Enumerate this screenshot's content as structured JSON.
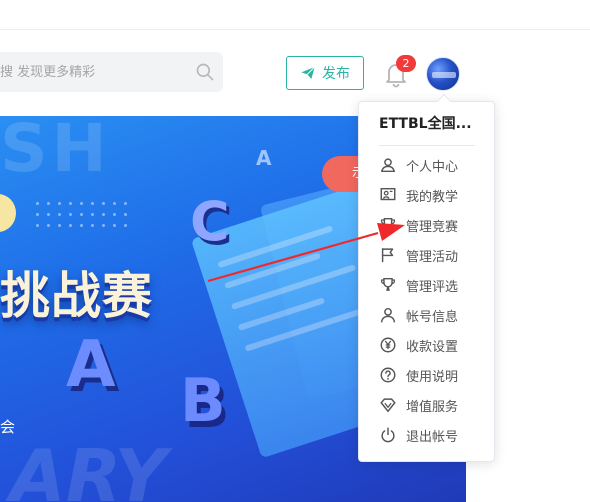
{
  "search": {
    "placeholder": "搜 发现更多精彩",
    "icon": "search-icon"
  },
  "header": {
    "publish_label": "发布",
    "notification_count": "2",
    "accent": "#2bb4a4",
    "badge_color": "#f23a3a"
  },
  "banner": {
    "title": "挑战赛",
    "bg_letters_top": "SH",
    "bg_letters_bottom": "ARY",
    "letters": [
      "C",
      "A",
      "B"
    ],
    "pill_text": "示",
    "sub_text": "会"
  },
  "menu": {
    "username": "ETTBL全国...",
    "items": [
      {
        "label": "个人中心",
        "icon": "user-icon"
      },
      {
        "label": "我的教学",
        "icon": "teaching-icon"
      },
      {
        "label": "管理竞赛",
        "icon": "trophy-icon"
      },
      {
        "label": "管理活动",
        "icon": "flag-icon"
      },
      {
        "label": "管理评选",
        "icon": "cup-icon"
      },
      {
        "label": "帐号信息",
        "icon": "account-icon"
      },
      {
        "label": "收款设置",
        "icon": "yen-icon"
      },
      {
        "label": "使用说明",
        "icon": "help-icon"
      },
      {
        "label": "增值服务",
        "icon": "diamond-icon"
      },
      {
        "label": "退出帐号",
        "icon": "power-icon"
      }
    ]
  },
  "annotation": {
    "arrow_color": "#f0282a"
  }
}
